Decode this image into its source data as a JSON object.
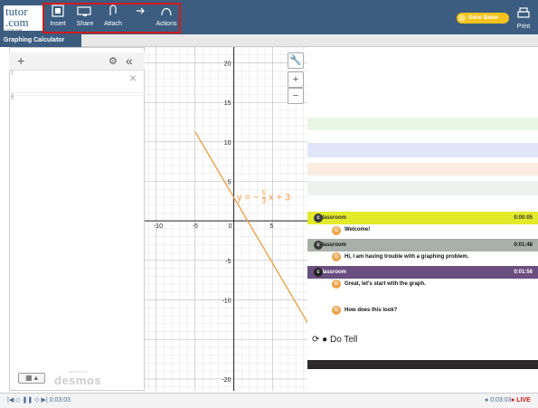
{
  "app": {
    "logo_line1": "tutor",
    "logo_line2": ".com",
    "logo_tagline": "TUTOR.COM"
  },
  "toolbar": {
    "insert_label": "Insert",
    "share_label": "Share",
    "attach_label": "Attach",
    "actions_label": "Actions",
    "print_label": "Print",
    "user_name": "Gene Baker"
  },
  "tabs": [
    {
      "label": "Graphing Calculator"
    }
  ],
  "calculator": {
    "add_label": "+",
    "settings_label": "⚙",
    "collapse_label": "«",
    "close_label": "×",
    "zoom_in_label": "+",
    "zoom_out_label": "−",
    "wrench_label": "🔧",
    "keyboard_label": "▦ ▴",
    "powered_by": "powered by",
    "brand": "desmos",
    "expression_labels": [
      "1",
      "2",
      "3"
    ],
    "equation": "y = −5/3 x + 3",
    "equation_left": "y = −",
    "equation_frac_num": "5",
    "equation_frac_den": "3",
    "equation_right": "x + 3",
    "x_ticks": [
      "-10",
      "-5",
      "0",
      "5"
    ],
    "y_ticks": [
      "20",
      "15",
      "10",
      "5",
      "-5",
      "-10",
      "-20"
    ]
  },
  "chart_data": {
    "type": "line",
    "series": [
      {
        "name": "",
        "x": [
          -5,
          12
        ],
        "y": [
          11.3,
          -17.0
        ]
      }
    ],
    "xlim": [
      -11.5,
      9.5
    ],
    "ylim": [
      -21.5,
      22
    ],
    "grid": true,
    "color": "#f0a24a"
  },
  "chat": {
    "messages": [
      {
        "badge": "c",
        "sender": "Classroom",
        "time": "0:00:05",
        "text": "Welcome!"
      },
      {
        "badge": "c",
        "sender": "Classroom",
        "time": "0:01:48",
        "text": "Hi, I am having trouble with a graphing problem."
      },
      {
        "badge": "c",
        "sender": "Classroom",
        "time": "0:01:56",
        "text": "Great, let's start with the graph."
      },
      {
        "badge": "G",
        "sender": "",
        "time": "",
        "text": "How does this look?"
      }
    ],
    "typing_label": "Do Tell"
  },
  "playback": {
    "controls": "|◀ ◇ ❚❚ ◇ ▶| 0:03:03",
    "elapsed": "0:03:03",
    "live_label": "LIVE"
  },
  "colors": {
    "topbar": "#3c5d80",
    "highlight": "#d21b1b",
    "user_chip": "#f4c21a",
    "line": "#f0a24a",
    "badge_green": "#3a3a3a",
    "badge_orange": "#f0a24a"
  }
}
